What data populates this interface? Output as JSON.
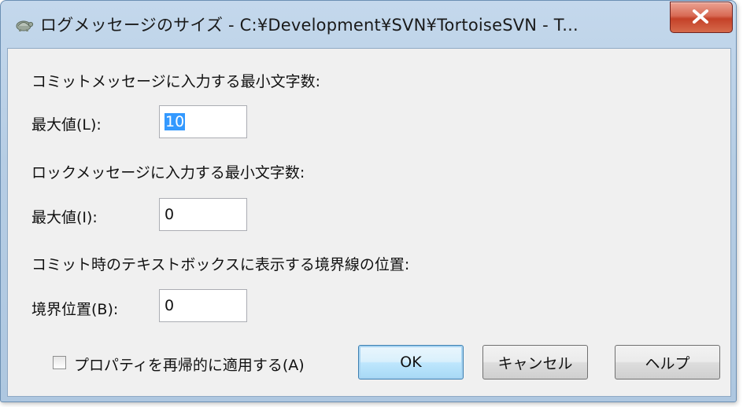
{
  "window": {
    "title": "ログメッセージのサイズ - C:¥Development¥SVN¥TortoiseSVN - T...",
    "icon": "tortoisesvn-turtle-icon",
    "close_label": "close"
  },
  "form": {
    "commit_heading": "コミットメッセージに入力する最小文字数:",
    "commit_max_label": "最大値(L):",
    "commit_max_value": "10",
    "lock_heading": "ロックメッセージに入力する最小文字数:",
    "lock_max_label": "最大値(I):",
    "lock_max_value": "0",
    "border_heading": "コミット時のテキストボックスに表示する境界線の位置:",
    "border_pos_label": "境界位置(B):",
    "border_pos_value": "0"
  },
  "footer": {
    "recursive_label": "プロパティを再帰的に適用する(A)",
    "recursive_checked": false,
    "ok_label": "OK",
    "cancel_label": "キャンセル",
    "help_label": "ヘルプ"
  },
  "colors": {
    "title_bar": "#b6cde4",
    "close_button": "#c44128",
    "selection": "#3399ff",
    "default_button_border": "#3c7fb1"
  }
}
